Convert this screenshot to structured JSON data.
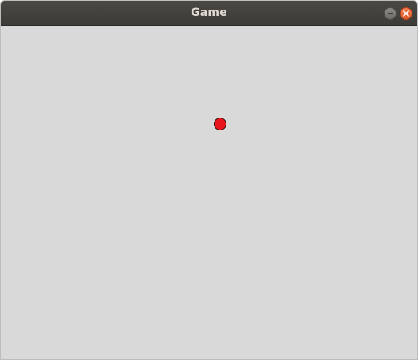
{
  "window": {
    "title": "Game",
    "controls": {
      "minimize_icon": "minimize-icon",
      "close_icon": "close-icon"
    }
  },
  "game": {
    "background_color": "#d9d9d9",
    "ball": {
      "color": "#e8151b",
      "outline_color": "#2a1010"
    }
  }
}
